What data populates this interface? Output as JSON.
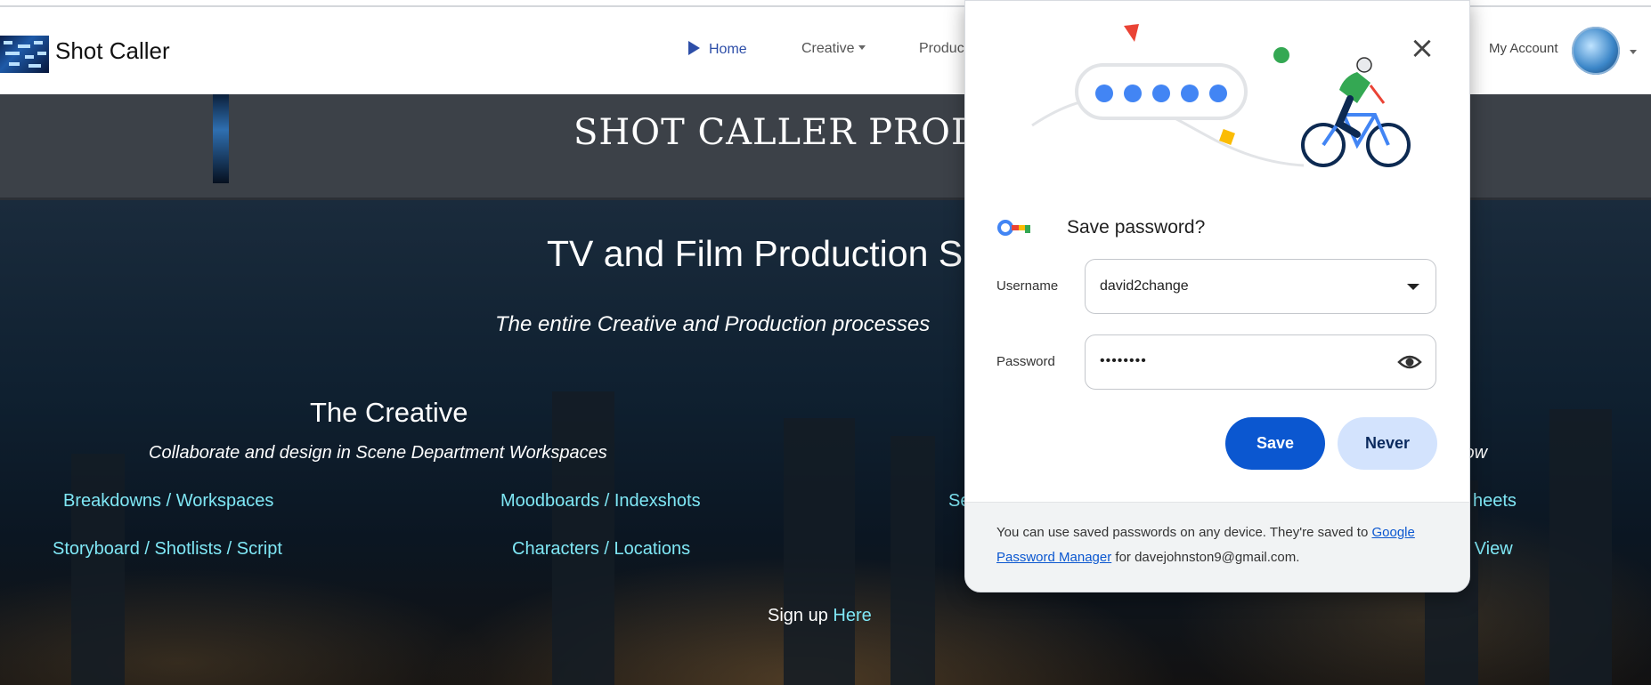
{
  "brand": "Shot Caller",
  "nav": {
    "home": "Home",
    "creative": "Creative",
    "production": "Produc",
    "account": "My Account"
  },
  "site_title": "SHOT CALLER PRODUC",
  "hero": {
    "title": "TV and Film Production S",
    "subtitle": "The entire Creative and Production processes",
    "creative": {
      "title": "The Creative",
      "subtitle": "Collaborate and design in Scene Department Workspaces"
    },
    "right_subtitle_fragment": "low",
    "links": {
      "breakdowns": "Breakdowns / Workspaces",
      "moodboards": "Moodboards / Indexshots",
      "storyboard": "Storyboard / Shotlists / Script",
      "characters": "Characters / Locations",
      "partial_se": "Se",
      "partial_sheets": "heets",
      "partial_view": "e View"
    },
    "signup_text": "Sign up",
    "signup_link": "Here"
  },
  "password_dialog": {
    "title": "Save password?",
    "username_label": "Username",
    "username_value": "david2change",
    "password_label": "Password",
    "password_masked": "••••••••",
    "save_label": "Save",
    "never_label": "Never",
    "footer_text_1": "You can use saved passwords on any device. They're saved to",
    "footer_link": "Google Password Manager",
    "footer_text_2": "for davejohnston9@gmail.com.",
    "close_icon": "close-icon",
    "key_icon": "key-icon",
    "eye_icon": "eye-icon",
    "accent_color": "#0b57d0"
  }
}
